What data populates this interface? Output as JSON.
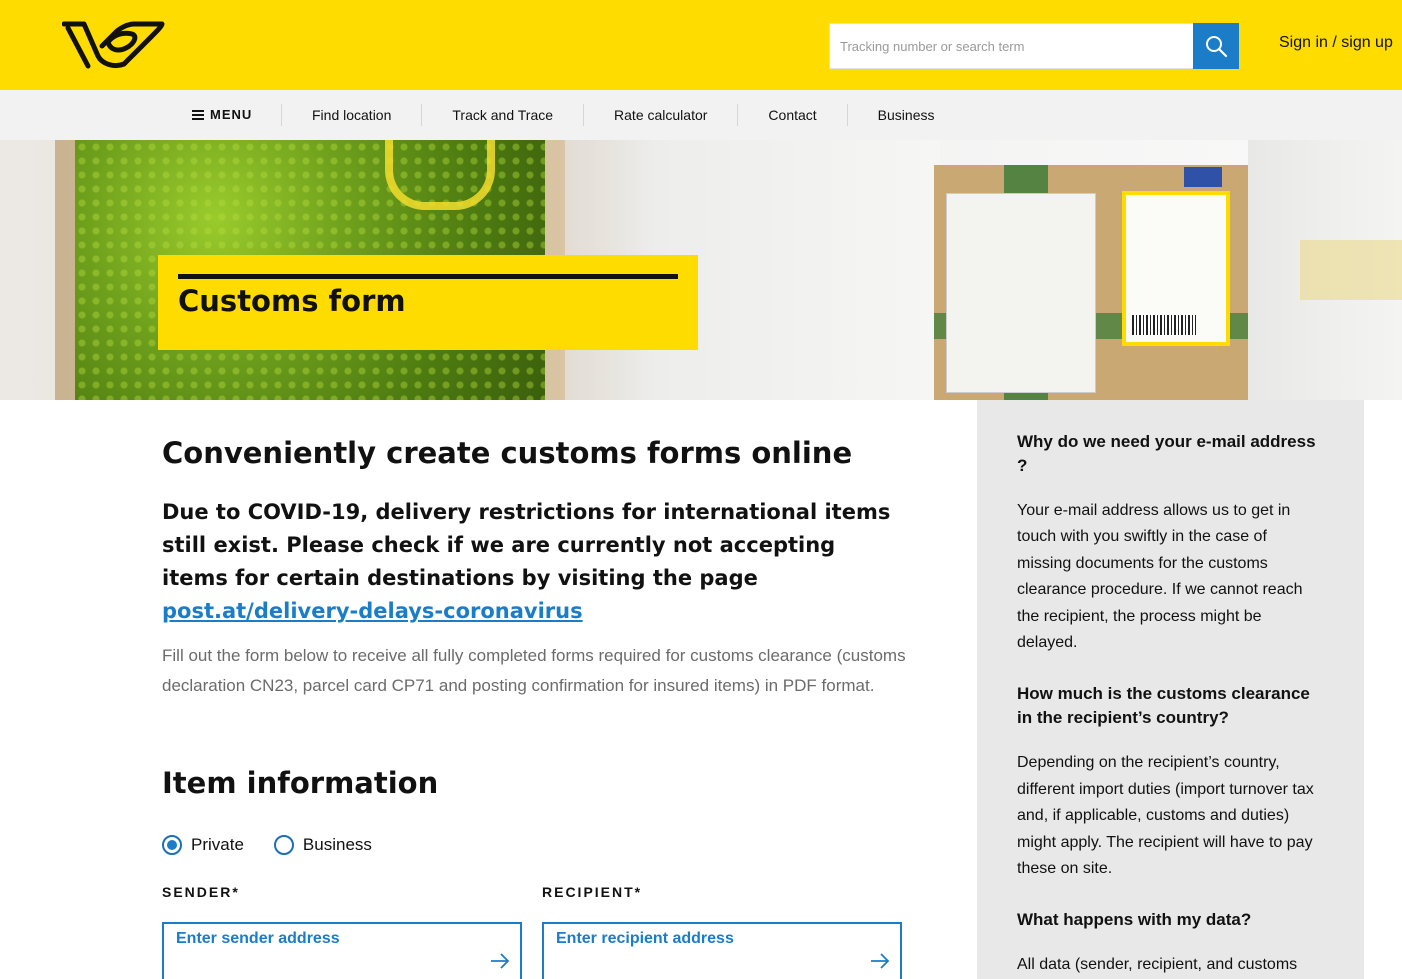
{
  "header": {
    "logo_name": "post-horn-logo",
    "search": {
      "placeholder": "Tracking number or search term",
      "value": ""
    },
    "signin_label": "Sign in / sign up"
  },
  "nav": {
    "menu_label": "MENU",
    "items": [
      {
        "label": "Find location"
      },
      {
        "label": "Track and Trace"
      },
      {
        "label": "Rate calculator"
      },
      {
        "label": "Contact"
      },
      {
        "label": "Business"
      }
    ]
  },
  "hero": {
    "title": "Customs form"
  },
  "main": {
    "heading": "Conveniently create customs forms online",
    "notice_text": "Due to COVID-19, delivery restrictions for international items still exist. Please check if we are currently not accepting items for certain destinations by visiting the page",
    "notice_link": " post.at/delivery-delays-coronavirus",
    "intro": "Fill out the form below to receive all fully completed forms required for customs clearance (customs declaration CN23, parcel card CP71 and posting confirmation for insured items) in PDF format.",
    "item_heading": "Item information",
    "radios": [
      {
        "label": "Private",
        "checked": true
      },
      {
        "label": "Business",
        "checked": false
      }
    ],
    "sender": {
      "label": "SENDER*",
      "placeholder": "Enter sender address"
    },
    "recipient": {
      "label": "RECIPIENT*",
      "placeholder": "Enter recipient address"
    }
  },
  "sidebar": {
    "faqs": [
      {
        "q": "Why do we need your e-mail address ?",
        "a": "Your e-mail address allows us to get in touch with you swiftly in the case of missing documents for the customs clearance procedure. If we cannot reach the recipient, the process might be delayed."
      },
      {
        "q": "How much is the customs clearance in the recipient’s country?",
        "a": "Depending on the recipient’s country, different import duties (import turnover tax and, if applicable, customs and duties) might apply. The recipient will have to pay these on site."
      },
      {
        "q": "What happens with my data?",
        "a": "All data (sender, recipient, and customs"
      }
    ]
  },
  "colors": {
    "brand_yellow": "#ffdc00",
    "accent_blue": "#1b7cc8",
    "nav_bg": "#f2f2f2",
    "sidebar_bg": "#e8e8e8"
  }
}
